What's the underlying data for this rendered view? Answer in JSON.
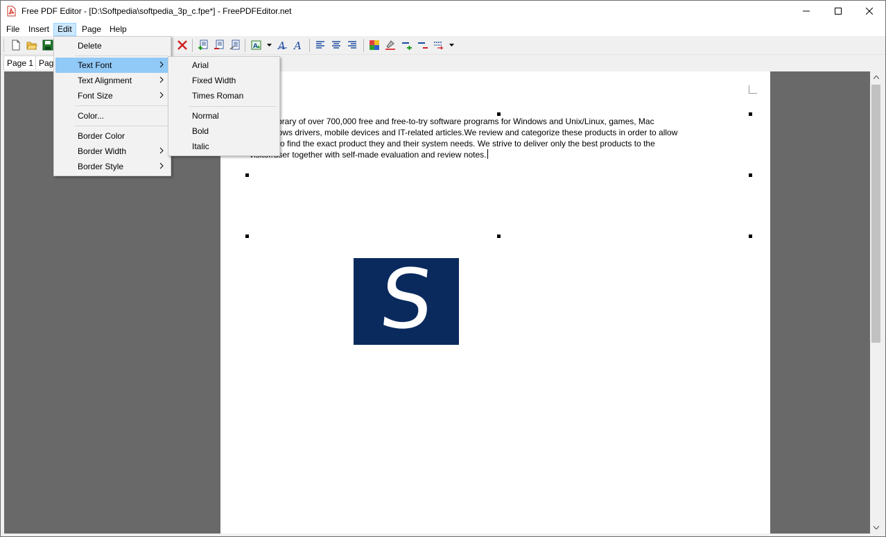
{
  "window": {
    "title": "Free PDF Editor - [D:\\Softpedia\\softpedia_3p_c.fpe*] - FreePDFEditor.net"
  },
  "menubar": {
    "items": [
      "File",
      "Insert",
      "Edit",
      "Page",
      "Help"
    ],
    "active": "Edit"
  },
  "tabs": {
    "page1": "Page 1",
    "page2": "Page"
  },
  "edit_menu": {
    "items": [
      "Delete",
      "Text Font",
      "Text Alignment",
      "Font Size",
      "Color...",
      "Border Color",
      "Border Width",
      "Border Style"
    ],
    "highlighted": "Text Font"
  },
  "font_submenu": {
    "items": [
      "Arial",
      "Fixed Width",
      "Times Roman",
      "Normal",
      "Bold",
      "Italic"
    ]
  },
  "document": {
    "line1": "ia is a library of over 700,000 free and free-to-try software programs for Windows and Unix/Linux, games, Mac",
    "line2": "e, Windows drivers, mobile devices and IT-related articles.We review and categorize these products in order to allow",
    "line3": "or/user to find the exact product they and their system needs. We strive to deliver only the best products to the",
    "line4": "visitor/user together with self-made evaluation and review notes.",
    "logo_letter": "S"
  },
  "colors": {
    "workspace": "#696969",
    "menu_highlight": "#91c9f7",
    "logo_bg": "#0a2a5e"
  },
  "icons": [
    "pdf-app-icon",
    "new-file-icon",
    "open-folder-icon",
    "save-icon",
    "delete-x-icon",
    "add-page-icon",
    "remove-page-icon",
    "page-properties-icon",
    "insert-image-icon",
    "text-font-icon",
    "text-italic-icon",
    "align-left-icon",
    "align-center-icon",
    "align-right-icon",
    "color-grid-icon",
    "fill-color-icon",
    "border-width-plus-icon",
    "border-width-minus-icon",
    "border-style-icon"
  ]
}
